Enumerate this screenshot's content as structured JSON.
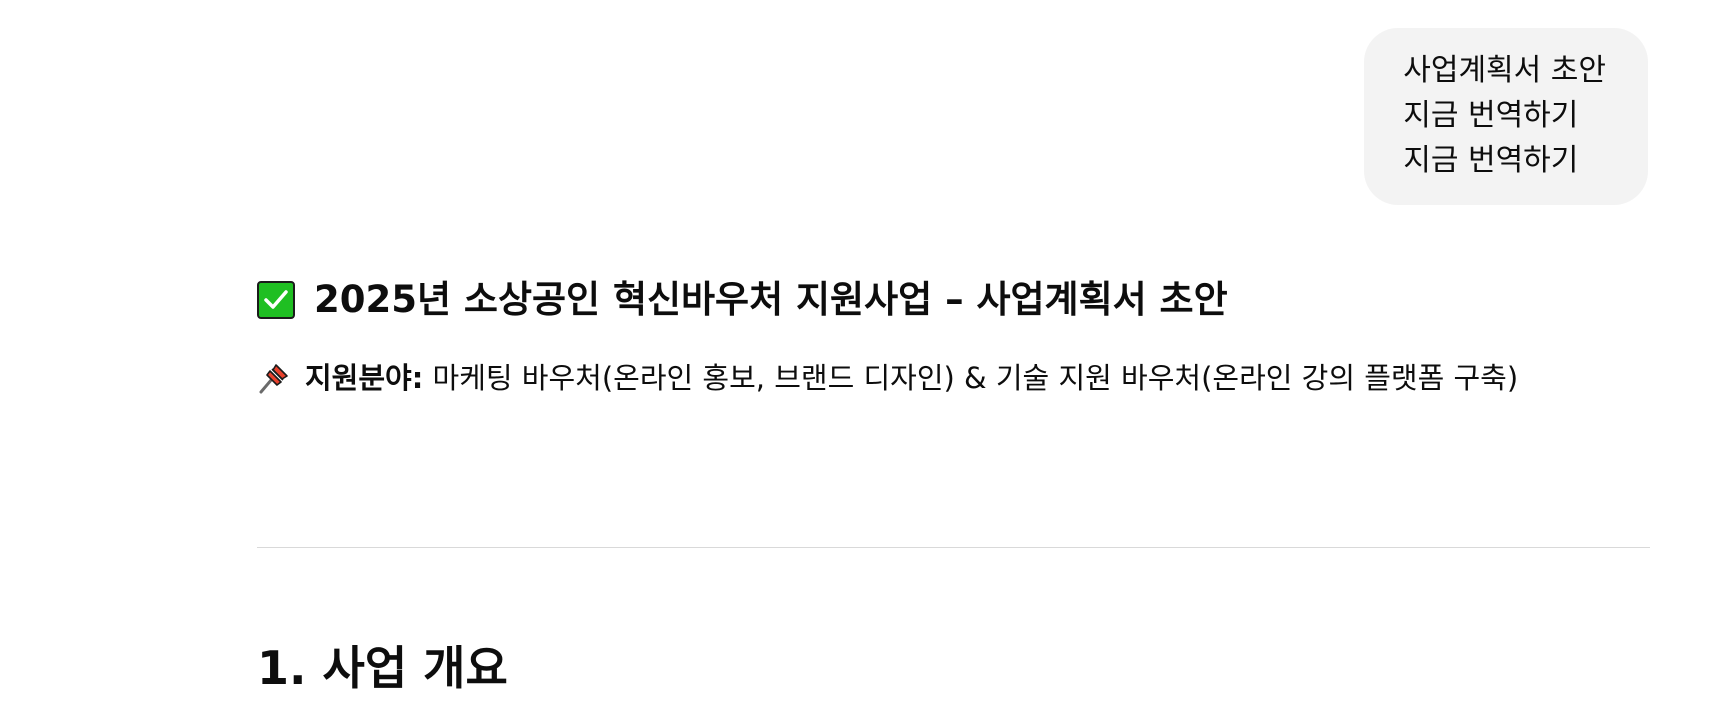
{
  "user_message": {
    "lines": [
      "사업계획서 초안",
      "지금 번역하기",
      "지금 번역하기"
    ]
  },
  "response": {
    "title_icon": "check-mark-button-icon",
    "title": "2025년 소상공인 혁신바우처 지원사업 – 사업계획서 초안",
    "support_icon": "pushpin-icon",
    "support_label": "지원분야:",
    "support_text": " 마케팅 바우처(온라인 홍보, 브랜드 디자인) & 기술 지원 바우처(온라인 강의 플랫폼 구축)",
    "section_heading": "1. 사업 개요"
  },
  "colors": {
    "bubble_bg": "#f3f3f3",
    "check_green": "#1fbf22",
    "pin_red": "#e8412c",
    "divider": "#d9d9d9",
    "text": "#0d0d0d"
  }
}
